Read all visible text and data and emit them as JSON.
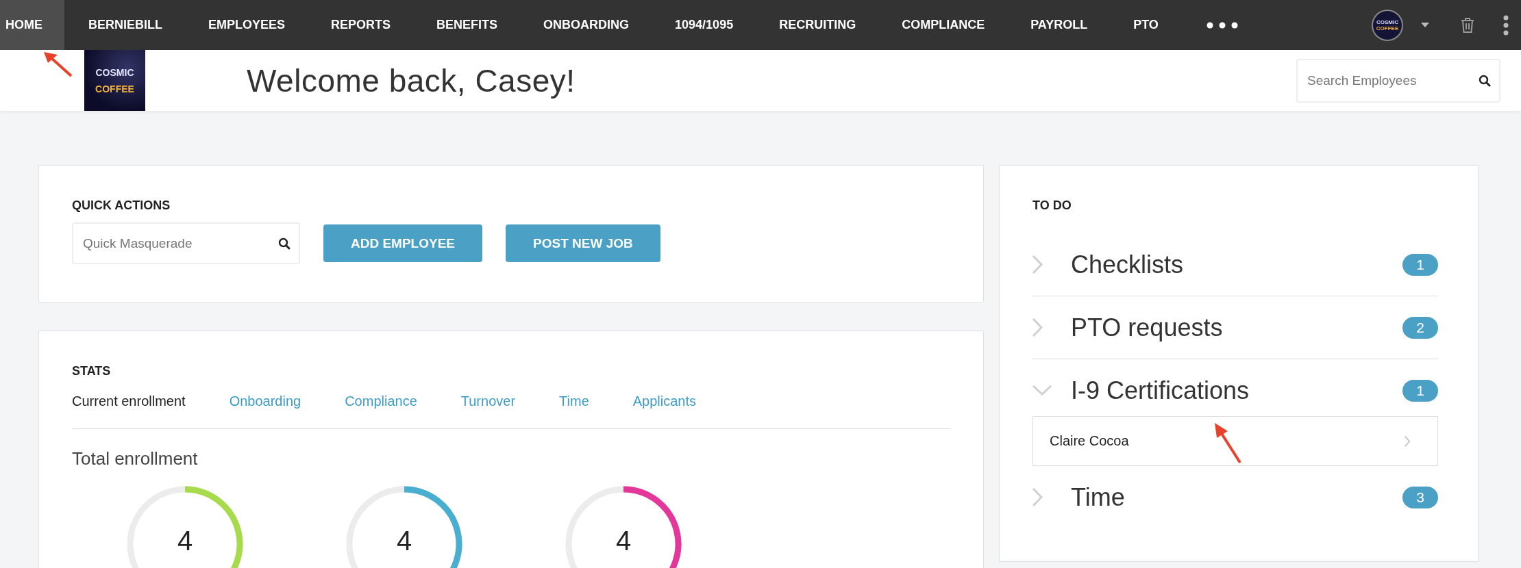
{
  "nav": {
    "items": [
      {
        "label": "HOME",
        "selected": true
      },
      {
        "label": "BERNIEBILL",
        "selected": false
      },
      {
        "label": "EMPLOYEES",
        "selected": false
      },
      {
        "label": "REPORTS",
        "selected": false
      },
      {
        "label": "BENEFITS",
        "selected": false
      },
      {
        "label": "ONBOARDING",
        "selected": false
      },
      {
        "label": "1094/1095",
        "selected": false
      },
      {
        "label": "RECRUITING",
        "selected": false
      },
      {
        "label": "COMPLIANCE",
        "selected": false
      },
      {
        "label": "PAYROLL",
        "selected": false
      },
      {
        "label": "PTO",
        "selected": false
      }
    ],
    "avatar": {
      "lines": [
        "COSMIC",
        "COFFEE"
      ]
    }
  },
  "header": {
    "logo": {
      "lines": [
        "COSMIC",
        "COFFEE"
      ]
    },
    "title": "Welcome back, Casey!",
    "search": {
      "placeholder": "Search Employees"
    }
  },
  "quick_actions": {
    "title": "QUICK ACTIONS",
    "search": {
      "placeholder": "Quick Masquerade"
    },
    "buttons": [
      "ADD EMPLOYEE",
      "POST NEW JOB"
    ]
  },
  "stats": {
    "title": "STATS",
    "tabs": [
      {
        "label": "Current enrollment",
        "selected": true
      },
      {
        "label": "Onboarding",
        "selected": false
      },
      {
        "label": "Compliance",
        "selected": false
      },
      {
        "label": "Turnover",
        "selected": false
      },
      {
        "label": "Time",
        "selected": false
      },
      {
        "label": "Applicants",
        "selected": false
      }
    ],
    "subtitle": "Total enrollment",
    "donuts": [
      {
        "value": "4",
        "color": "#a8db4c"
      },
      {
        "value": "4",
        "color": "#4aaed0"
      },
      {
        "value": "4",
        "color": "#e3389a"
      }
    ]
  },
  "todo": {
    "title": "TO DO",
    "items": [
      {
        "label": "Checklists",
        "count": "1",
        "expanded": false
      },
      {
        "label": "PTO requests",
        "count": "2",
        "expanded": false
      },
      {
        "label": "I-9 Certifications",
        "count": "1",
        "expanded": true,
        "children": [
          {
            "label": "Claire Cocoa"
          }
        ]
      },
      {
        "label": "Time",
        "count": "3",
        "expanded": false
      }
    ]
  }
}
